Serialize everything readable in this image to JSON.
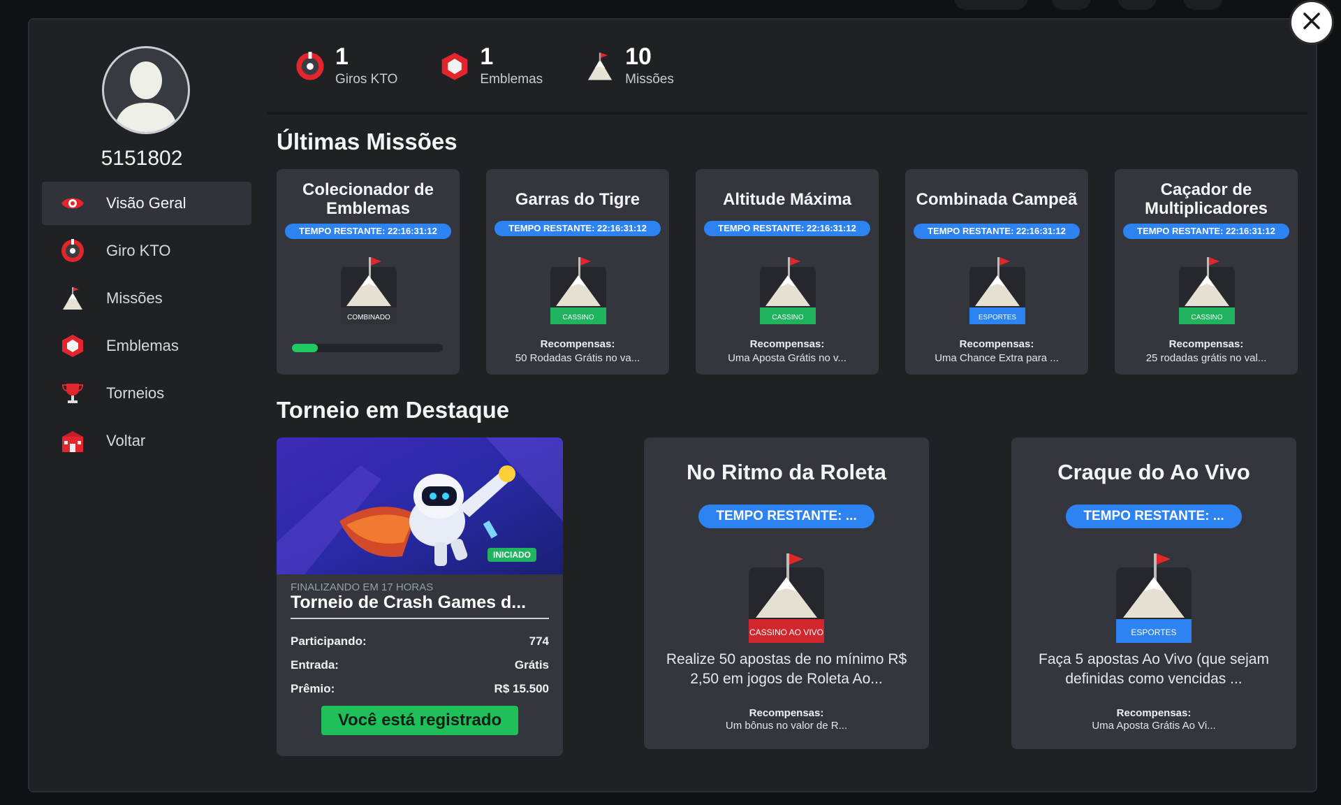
{
  "profile": {
    "username": "5151802"
  },
  "nav": [
    {
      "label": "Visão Geral",
      "icon": "eye-icon",
      "active": true
    },
    {
      "label": "Giro KTO",
      "icon": "wheel-icon"
    },
    {
      "label": "Missões",
      "icon": "mountain-flag-icon"
    },
    {
      "label": "Emblemas",
      "icon": "emblem-icon"
    },
    {
      "label": "Torneios",
      "icon": "trophy-icon"
    },
    {
      "label": "Voltar",
      "icon": "casino-building-icon"
    }
  ],
  "stats": [
    {
      "value": "1",
      "label": "Giros KTO",
      "icon": "wheel-icon"
    },
    {
      "value": "1",
      "label": "Emblemas",
      "icon": "emblem-icon"
    },
    {
      "value": "10",
      "label": "Missões",
      "icon": "mountain-flag-icon"
    }
  ],
  "missions_title": "Últimas Missões",
  "missions": [
    {
      "title": "Colecionador de Emblemas",
      "timer": "TEMPO RESTANTE: 22:16:31:12",
      "tag": "COMBINADO",
      "tag_color": "#2f3237",
      "progress": 0.17
    },
    {
      "title": "Garras do Tigre",
      "timer": "TEMPO RESTANTE: 22:16:31:12",
      "tag": "CASSINO",
      "tag_color": "#1fb45d",
      "rewards_label": "Recompensas:",
      "reward": "50 Rodadas Grátis no va..."
    },
    {
      "title": "Altitude Máxima",
      "timer": "TEMPO RESTANTE: 22:16:31:12",
      "tag": "CASSINO",
      "tag_color": "#1fb45d",
      "rewards_label": "Recompensas:",
      "reward": "Uma Aposta Grátis no v..."
    },
    {
      "title": "Combinada Campeã",
      "timer": "TEMPO RESTANTE: 22:16:31:12",
      "tag": "ESPORTES",
      "tag_color": "#2d83f2",
      "rewards_label": "Recompensas:",
      "reward": "Uma Chance Extra para ..."
    },
    {
      "title": "Caçador de Multiplicadores",
      "timer": "TEMPO RESTANTE: 22:16:31:12",
      "tag": "CASSINO",
      "tag_color": "#1fb45d",
      "rewards_label": "Recompensas:",
      "reward": "25 rodadas grátis no val..."
    }
  ],
  "tournament_title": "Torneio em Destaque",
  "featured": {
    "status": "INICIADO",
    "subtitle": "FINALIZANDO EM 17 HORAS",
    "name": "Torneio de Crash Games d...",
    "rows": [
      {
        "label": "Participando:",
        "value": "774"
      },
      {
        "label": "Entrada:",
        "value": "Grátis"
      },
      {
        "label": "Prêmio:",
        "value": "R$ 15.500"
      }
    ],
    "cta": "Você está registrado"
  },
  "tournaments": [
    {
      "title": "No Ritmo da Roleta",
      "timer": "TEMPO RESTANTE: ...",
      "tag": "CASSINO AO VIVO",
      "tag_color": "#d0262c",
      "description": "Realize 50 apostas de no mínimo R$ 2,50 em jogos de Roleta Ao...",
      "rewards_label": "Recompensas:",
      "reward": "Um bônus no valor de R..."
    },
    {
      "title": "Craque do Ao Vivo",
      "timer": "TEMPO RESTANTE: ...",
      "tag": "ESPORTES",
      "tag_color": "#2d83f2",
      "description": "Faça 5 apostas Ao Vivo (que sejam definidas como vencidas ...",
      "rewards_label": "Recompensas:",
      "reward": "Uma Aposta Grátis Ao Vi..."
    }
  ],
  "colors": {
    "accent_blue": "#2d83f2",
    "accent_green": "#1fbf5a",
    "brand_red": "#e3262c"
  }
}
